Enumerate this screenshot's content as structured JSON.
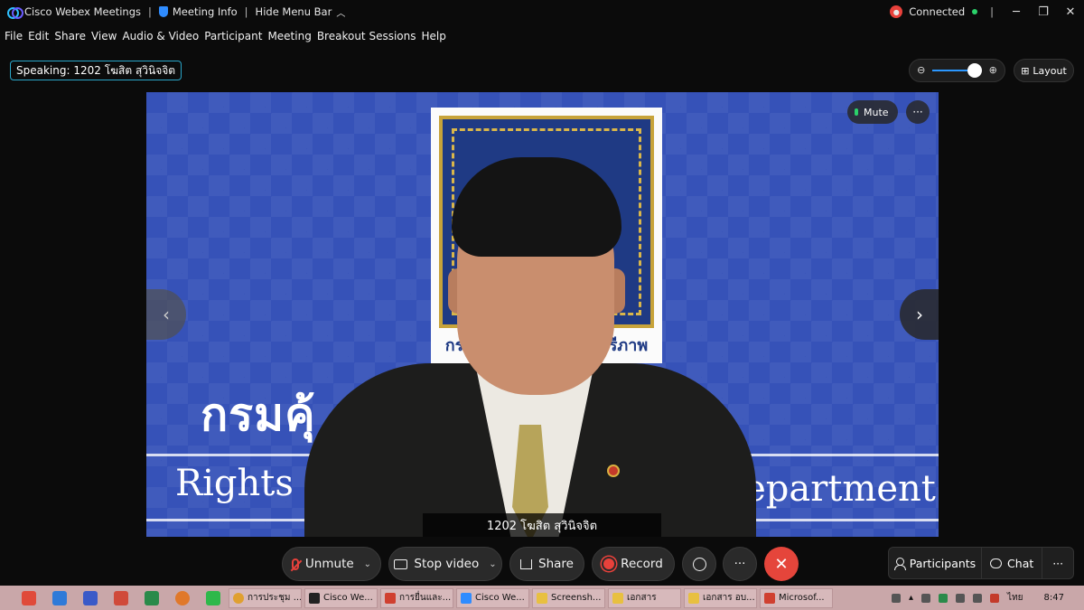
{
  "titlebar": {
    "app_name": "Cisco Webex Meetings",
    "meeting_info": "Meeting Info",
    "hide_menu": "Hide Menu Bar",
    "status": "Connected",
    "sep": "|",
    "minimize": "─",
    "restore": "❐",
    "close": "✕"
  },
  "menu": [
    "File",
    "Edit",
    "Share",
    "View",
    "Audio & Video",
    "Participant",
    "Meeting",
    "Breakout Sessions",
    "Help"
  ],
  "speaking": "Speaking: 1202 โฆสิต สุวินิจจิต",
  "zoom": {
    "level": 1.0,
    "out_icon": "⊖",
    "in_icon": "⊕"
  },
  "layout_label": "Layout",
  "video": {
    "emblem_text": "กรมคุ้มครองสิทธิและเสรีภาพ",
    "banner_thai": "กรมคุ้        สรีภาพ",
    "banner_en_left": "Rights a",
    "banner_en_right": "Department",
    "name_tag": "1202 โฆสิต สุวินิจจิต",
    "mute_label": "Mute",
    "more": "···",
    "nav_prev": "‹",
    "nav_next": "›"
  },
  "controls": {
    "unmute": "Unmute",
    "stop_video": "Stop video",
    "share": "Share",
    "record": "Record",
    "more": "···",
    "end": "✕",
    "participants": "Participants",
    "chat": "Chat",
    "caret": "⌄"
  },
  "taskbar": {
    "items": [
      {
        "label": "การประชุม ...",
        "color": "#e0a030"
      },
      {
        "label": "Cisco We...",
        "color": "#222222"
      },
      {
        "label": "การยื่นและ...",
        "color": "#d04030"
      },
      {
        "label": "Cisco We...",
        "color": "#2f8cff"
      },
      {
        "label": "Screensh...",
        "color": "#e8c040"
      },
      {
        "label": "เอกสาร",
        "color": "#e8c040"
      },
      {
        "label": "เอกสาร อบ...",
        "color": "#e8c040"
      },
      {
        "label": "Microsof...",
        "color": "#d04030"
      }
    ],
    "lang": "ไทย",
    "time": "8:47"
  }
}
